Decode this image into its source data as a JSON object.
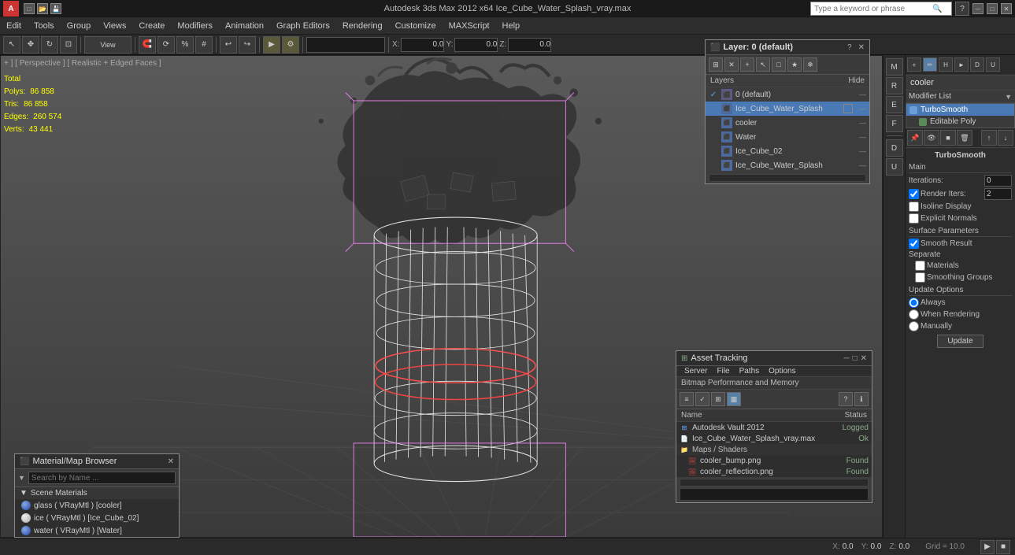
{
  "titlebar": {
    "title": "Autodesk 3ds Max  2012 x64    Ice_Cube_Water_Splash_vray.max",
    "logo": "A",
    "search_placeholder": "Type a keyword or phrase"
  },
  "menubar": {
    "items": [
      "Edit",
      "Tools",
      "Group",
      "Views",
      "Create",
      "Modifiers",
      "Animation",
      "Graph Editors",
      "Rendering",
      "Customize",
      "MAXScript",
      "Help"
    ]
  },
  "viewport": {
    "label": "+ ] [ Perspective ] [ Realistic + Edged Faces ]",
    "stats": {
      "total_label": "Total",
      "polys_label": "Polys:",
      "polys_val": "86 858",
      "tris_label": "Tris:",
      "tris_val": "86 858",
      "edges_label": "Edges:",
      "edges_val": "260 574",
      "verts_label": "Verts:",
      "verts_val": "43 441"
    }
  },
  "layers_panel": {
    "title": "Layer: 0 (default)",
    "layers_col": "Layers",
    "hide_col": "Hide",
    "items": [
      {
        "name": "0 (default)",
        "check": "✓",
        "active": false
      },
      {
        "name": "Ice_Cube_Water_Splash",
        "check": "",
        "active": true,
        "square": true
      },
      {
        "name": "cooler",
        "check": "",
        "active": false
      },
      {
        "name": "Water",
        "check": "",
        "active": false
      },
      {
        "name": "Ice_Cube_02",
        "check": "",
        "active": false
      },
      {
        "name": "Ice_Cube_Water_Splash",
        "check": "",
        "active": false
      }
    ]
  },
  "asset_panel": {
    "title": "Asset Tracking",
    "menu_items": [
      "Server",
      "File",
      "Paths",
      "Options"
    ],
    "info": "Bitmap Performance and Memory",
    "cols": {
      "name": "Name",
      "status": "Status"
    },
    "items": [
      {
        "name": "Autodesk Vault 2012",
        "status": "Logged",
        "type": "vault",
        "indent": false
      },
      {
        "name": "Ice_Cube_Water_Splash_vray.max",
        "status": "Ok",
        "type": "file",
        "indent": false
      },
      {
        "name": "Maps / Shaders",
        "status": "",
        "type": "group",
        "indent": false
      },
      {
        "name": "cooler_bump.png",
        "status": "Found",
        "type": "image",
        "indent": true
      },
      {
        "name": "cooler_reflection.png",
        "status": "Found",
        "type": "image",
        "indent": true
      }
    ]
  },
  "material_panel": {
    "title": "Material/Map Browser",
    "search_placeholder": "Search by Name ...",
    "section_title": "Scene Materials",
    "materials": [
      {
        "name": "glass ( VRayMtl ) [cooler]"
      },
      {
        "name": "ice ( VRayMtl ) [Ice_Cube_02]"
      },
      {
        "name": "water ( VRayMtl ) [Water]"
      }
    ]
  },
  "right_panel": {
    "cooler_label": "cooler",
    "modifier_list_label": "Modifier List",
    "modifiers": [
      {
        "name": "TurboSmooth",
        "type": "active"
      },
      {
        "name": "Editable Poly",
        "type": "sub"
      }
    ],
    "turbosmooth": {
      "title": "TurboSmooth",
      "main_label": "Main",
      "iterations_label": "Iterations:",
      "iterations_val": "0",
      "render_iters_label": "Render Iters:",
      "render_iters_val": "2",
      "render_iters_checked": true,
      "isoline_label": "Isoline Display",
      "explicit_label": "Explicit Normals",
      "surface_label": "Surface Parameters",
      "smooth_result_label": "Smooth Result",
      "smooth_result_checked": true,
      "separate_label": "Separate",
      "materials_label": "Materials",
      "smoothing_label": "Smoothing Groups",
      "update_label": "Update Options",
      "always_label": "Always",
      "when_rendering_label": "When Rendering",
      "manually_label": "Manually",
      "update_btn": "Update"
    }
  }
}
